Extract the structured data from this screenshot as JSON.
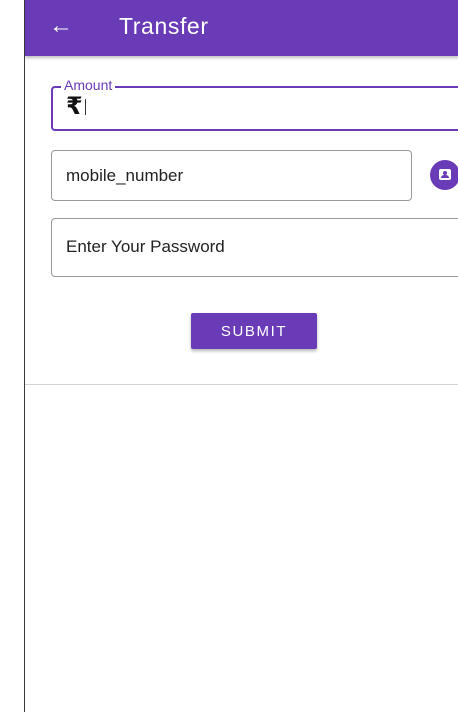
{
  "appbar": {
    "back_icon": "←",
    "title": "Transfer",
    "color": "#6a3bb7"
  },
  "amount": {
    "label": "Amount",
    "value": "₹"
  },
  "mobile": {
    "placeholder": "mobile_number",
    "contact_icon": "contact-card-icon"
  },
  "password": {
    "placeholder": "Enter Your Password"
  },
  "submit": {
    "label": "SUBMIT"
  }
}
